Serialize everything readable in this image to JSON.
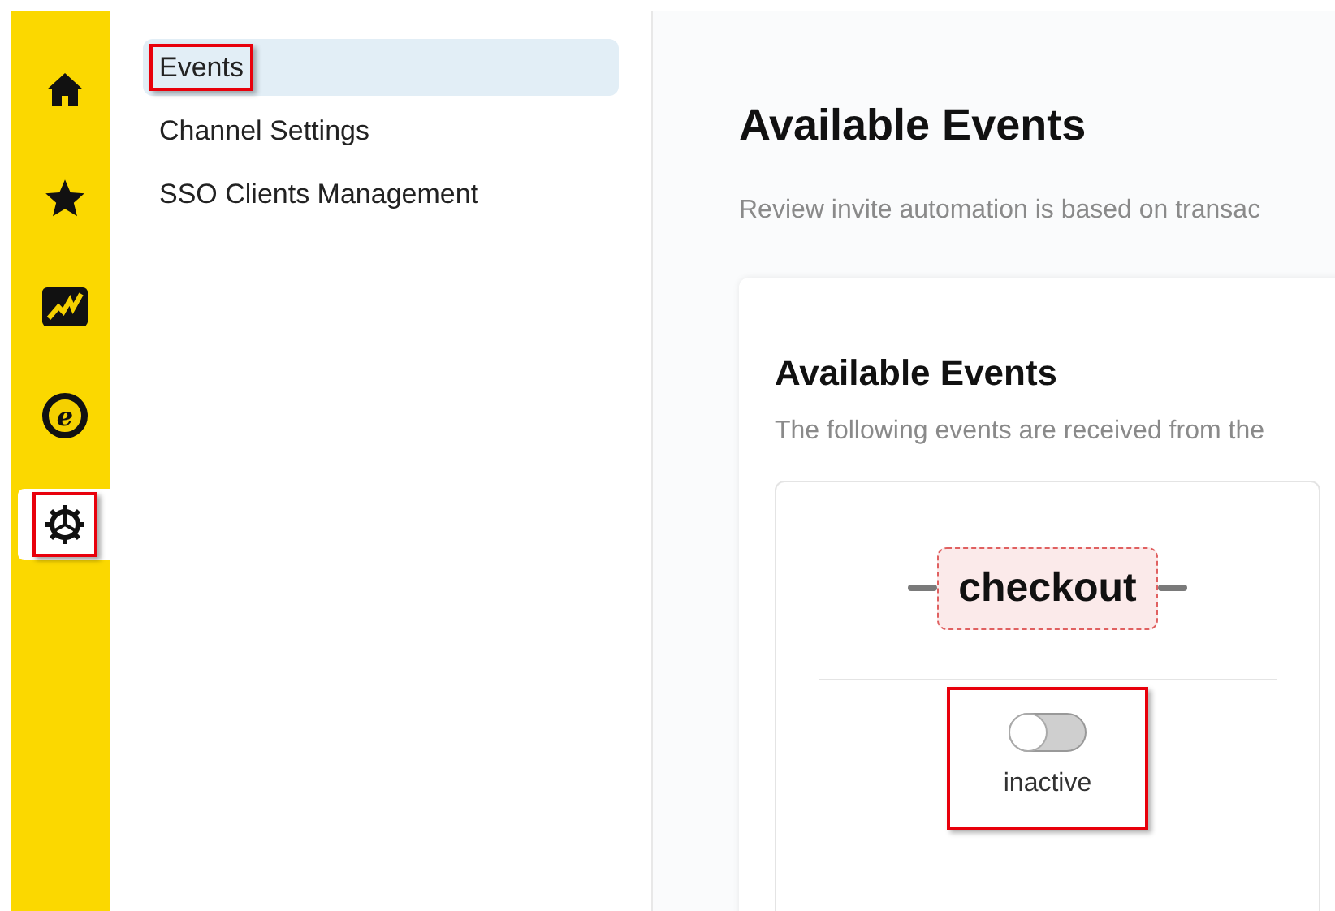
{
  "rail": [
    {
      "kind": "home",
      "selected": false,
      "highlighted": false
    },
    {
      "kind": "star",
      "selected": false,
      "highlighted": false
    },
    {
      "kind": "chart",
      "selected": false,
      "highlighted": false
    },
    {
      "kind": "coin",
      "glyph": "e",
      "selected": false,
      "highlighted": false
    },
    {
      "kind": "gear",
      "selected": true,
      "highlighted": true
    }
  ],
  "nav": [
    {
      "label": "Events",
      "selected": true,
      "highlighted": true
    },
    {
      "label": "Channel Settings",
      "selected": false,
      "highlighted": false
    },
    {
      "label": "SSO Clients Management",
      "selected": false,
      "highlighted": false
    }
  ],
  "page": {
    "title": "Available Events",
    "description": "Review invite automation is based on transac"
  },
  "card": {
    "title": "Available Events",
    "description": "The following events are received from the"
  },
  "events": [
    {
      "name": "checkout",
      "on": false,
      "status": "inactive",
      "highlighted": true
    }
  ]
}
